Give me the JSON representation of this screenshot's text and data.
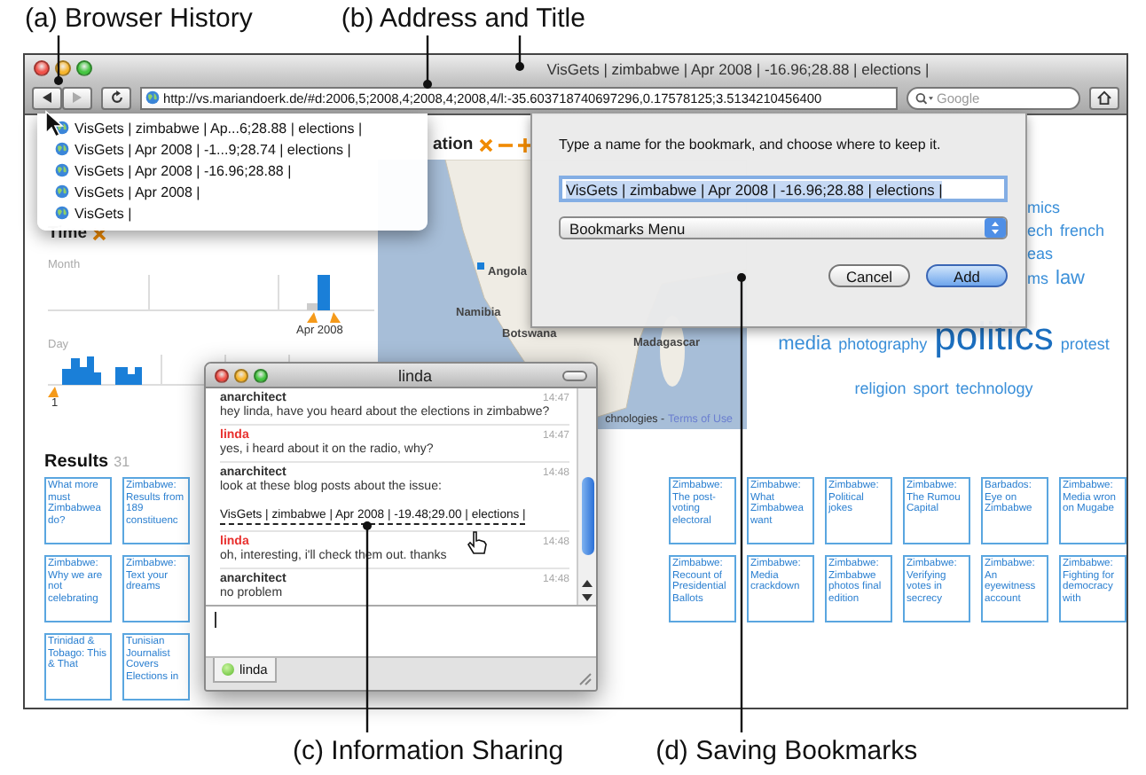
{
  "callouts_top": [
    {
      "label": "(a) Browser History"
    },
    {
      "label": "(b) Address and Title"
    }
  ],
  "callouts_bottom": [
    {
      "label": "(c) Information Sharing"
    },
    {
      "label": "(d) Saving Bookmarks"
    }
  ],
  "window": {
    "title": "VisGets | zimbabwe | Apr 2008 | -16.96;28.88 | elections |"
  },
  "toolbar": {
    "address": "http://vs.mariandoerk.de/#d:2006,5;2008,4;2008,4;2008,4/l:-35.603718740697296,0.17578125;3.5134210456400",
    "search": {
      "placeholder": "Google"
    }
  },
  "history_menu": {
    "items": [
      {
        "label": "VisGets | zimbabwe | Ap...6;28.88 | elections |"
      },
      {
        "label": "VisGets | Apr 2008 | -1...9;28.74 | elections |"
      },
      {
        "label": "VisGets | Apr 2008 | -16.96;28.88 |"
      },
      {
        "label": "VisGets | Apr 2008 |"
      },
      {
        "label": "VisGets |"
      }
    ]
  },
  "time_panel": {
    "title": "Time",
    "month_label": "Month",
    "month_marker": "Apr 2008",
    "day_label": "Day",
    "day_marker": "1"
  },
  "location_panel": {
    "title": "ation",
    "map_labels": [
      {
        "text": "Angola"
      },
      {
        "text": "Namibia"
      },
      {
        "text": "Botswana"
      },
      {
        "text": "Madagascar"
      }
    ],
    "attribution": "chnologies -",
    "terms_link": "Terms of Use"
  },
  "tag_cloud": {
    "lines": [
      {
        "kind": "clipped",
        "words": [
          {
            "text": "mics",
            "kind": "normal"
          }
        ]
      },
      {
        "kind": "clipped",
        "words": [
          {
            "text": "ech",
            "kind": "normal"
          },
          {
            "text": "french",
            "kind": "normal"
          }
        ]
      },
      {
        "kind": "clipped",
        "words": [
          {
            "text": "eas",
            "kind": "normal"
          }
        ]
      },
      {
        "kind": "clipped",
        "words": [
          {
            "text": "ms",
            "kind": "normal"
          },
          {
            "text": "law",
            "kind": "medium"
          }
        ]
      },
      {
        "kind": "full",
        "words": [
          {
            "text": "media",
            "kind": "medium"
          },
          {
            "text": "photography",
            "kind": "normal"
          },
          {
            "text": "politics",
            "kind": "large"
          },
          {
            "text": "protest",
            "kind": "normal"
          }
        ]
      },
      {
        "kind": "full",
        "words": [
          {
            "text": "religion",
            "kind": "normal"
          },
          {
            "text": "sport",
            "kind": "normal"
          },
          {
            "text": "technology",
            "kind": "normal"
          }
        ]
      }
    ]
  },
  "results": {
    "title": "Results",
    "count": "31",
    "rows": [
      {
        "cells": [
          {
            "kind": "article",
            "text": "What more must Zimbabwea do?"
          },
          {
            "kind": "article",
            "text": "Zimbabwe: Results from 189 constituenc"
          },
          {
            "kind": "covered"
          },
          {
            "kind": "covered"
          },
          {
            "kind": "covered"
          },
          {
            "kind": "covered"
          },
          {
            "kind": "covered"
          },
          {
            "kind": "covered"
          },
          {
            "kind": "article",
            "text": "Zimbabwe: The post-voting electoral"
          },
          {
            "kind": "article",
            "text": "Zimbabwe: What Zimbabwea want"
          },
          {
            "kind": "article",
            "text": "Zimbabwe: Political jokes"
          },
          {
            "kind": "article",
            "text": "Zimbabwe: The Rumou Capital"
          },
          {
            "kind": "article",
            "text": "Barbados: Eye on Zimbabwe"
          },
          {
            "kind": "article",
            "text": "Zimbabwe: Media wron on Mugabe"
          }
        ]
      },
      {
        "cells": [
          {
            "kind": "article",
            "text": "Zimbabwe: Why we are not celebrating"
          },
          {
            "kind": "article",
            "text": "Zimbabwe: Text your dreams"
          },
          {
            "kind": "covered"
          },
          {
            "kind": "covered"
          },
          {
            "kind": "covered"
          },
          {
            "kind": "covered"
          },
          {
            "kind": "covered"
          },
          {
            "kind": "covered"
          },
          {
            "kind": "article",
            "text": "Zimbabwe: Recount of Presidential Ballots"
          },
          {
            "kind": "article",
            "text": "Zimbabwe: Media crackdown"
          },
          {
            "kind": "article",
            "text": "Zimbabwe: Zimbabwe photos final edition"
          },
          {
            "kind": "article",
            "text": "Zimbabwe: Verifying votes in secrecy"
          },
          {
            "kind": "article",
            "text": "Zimbabwe: An eyewitness account"
          },
          {
            "kind": "article",
            "text": "Zimbabwe: Fighting for democracy with"
          }
        ]
      },
      {
        "cells": [
          {
            "kind": "article",
            "text": "Trinidad & Tobago: This & That"
          },
          {
            "kind": "article",
            "text": "Tunisian Journalist Covers Elections in"
          },
          {
            "kind": "covered"
          }
        ]
      }
    ]
  },
  "bookmark_dialog": {
    "prompt": "Type a name for the bookmark, and choose where to keep it.",
    "name_value": "VisGets | zimbabwe | Apr 2008 | -16.96;28.88 | elections |",
    "folder": "Bookmarks Menu",
    "buttons": [
      {
        "label": "Cancel",
        "default": false
      },
      {
        "label": "Add",
        "default": true
      }
    ]
  },
  "chat": {
    "title": "linda",
    "messages": [
      {
        "sender": "anarchitect",
        "color": "#333333",
        "time": "14:47",
        "text": "hey linda, have you heard about the elections in zimbabwe?"
      },
      {
        "sender": "linda",
        "color": "#e8312f",
        "time": "14:47",
        "text": "yes, i heard about it on the radio, why?"
      },
      {
        "sender": "anarchitect",
        "color": "#333333",
        "time": "14:48",
        "text": "look at these blog posts about the issue:",
        "link": "VisGets | zimbabwe | Apr 2008 | -19.48;29.00 | elections |"
      },
      {
        "sender": "linda",
        "color": "#e8312f",
        "time": "14:48",
        "text": "oh, interesting, i'll check them out. thanks"
      },
      {
        "sender": "anarchitect",
        "color": "#333333",
        "time": "14:48",
        "text": "no problem"
      }
    ],
    "tab": {
      "label": "linda"
    }
  }
}
